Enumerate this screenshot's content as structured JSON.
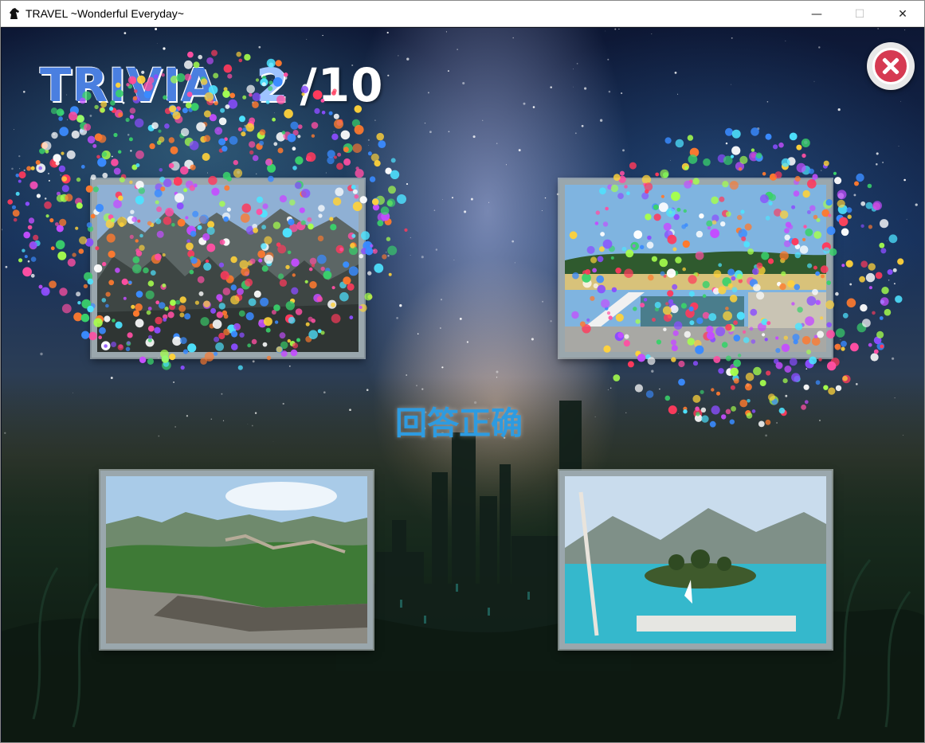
{
  "window": {
    "title": "TRAVEL ~Wonderful Everyday~",
    "controls": {
      "minimize": "—",
      "maximize": "☐",
      "close": "✕"
    }
  },
  "game": {
    "score": {
      "label": "TRIVIA",
      "current": "2",
      "total": "/10"
    },
    "status_message": "回答正确",
    "photos": [
      {
        "id": "top-left",
        "scene": "rocky-karst-landscape"
      },
      {
        "id": "top-right",
        "scene": "plaza-with-stairs"
      },
      {
        "id": "bottom-left",
        "scene": "great-wall"
      },
      {
        "id": "bottom-right",
        "scene": "lake-island"
      }
    ],
    "icons": {
      "app": "horse-head-icon",
      "close": "close-circle-icon"
    }
  }
}
